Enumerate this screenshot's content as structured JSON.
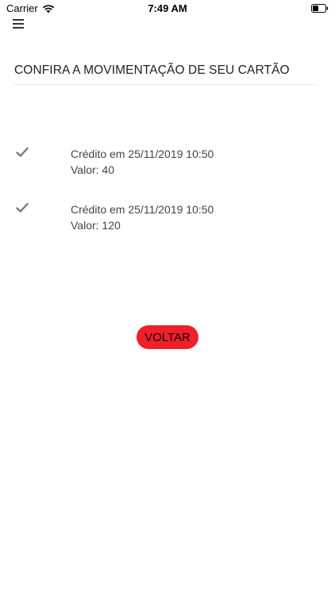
{
  "status_bar": {
    "carrier": "Carrier",
    "time": "7:49 AM",
    "wifi_icon": "wifi-icon",
    "battery_icon": "battery-icon"
  },
  "menu": {
    "icon": "hamburger-menu-icon"
  },
  "page": {
    "title": "CONFIRA A MOVIMENTAÇÃO DE SEU CARTÃO"
  },
  "transactions": [
    {
      "icon": "checkmark-icon",
      "line1": "Crédito em 25/11/2019 10:50",
      "line2": "Valor: 40"
    },
    {
      "icon": "checkmark-icon",
      "line1": "Crédito em 25/11/2019 10:50",
      "line2": "Valor: 120"
    }
  ],
  "back_button": {
    "label": "VOLTAR",
    "color": "#f0202b"
  }
}
